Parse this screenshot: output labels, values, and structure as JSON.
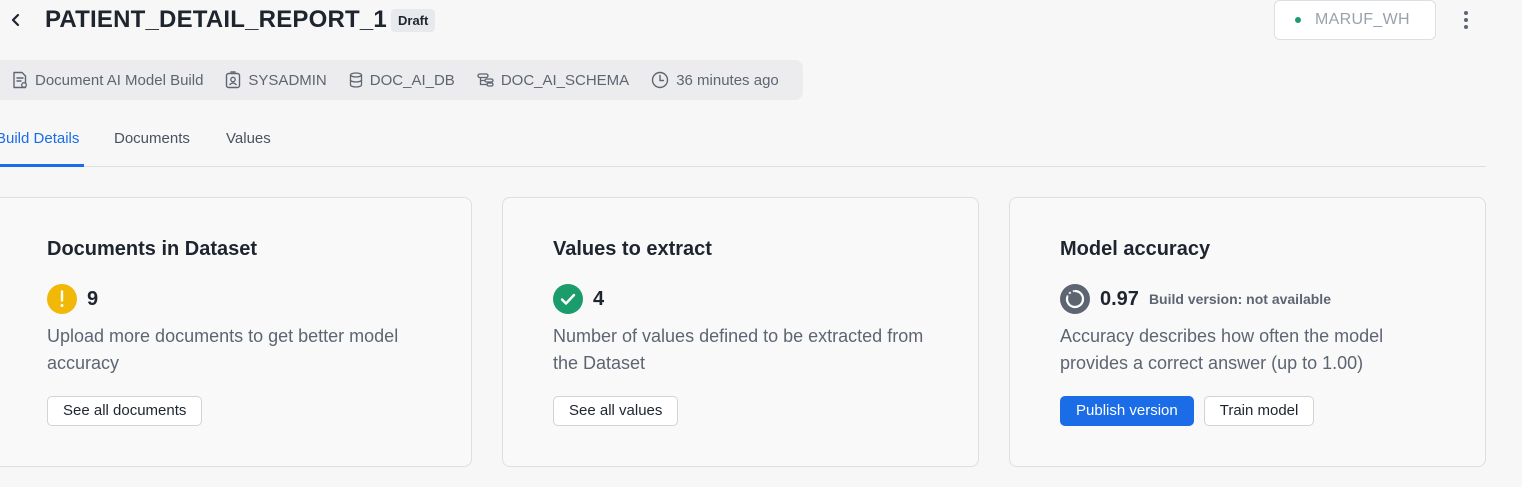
{
  "header": {
    "title": "PATIENT_DETAIL_REPORT_1",
    "badge": "Draft",
    "warehouse": "MARUF_WH"
  },
  "meta": [
    {
      "icon": "document-icon",
      "text": "Document AI Model Build"
    },
    {
      "icon": "user-badge-icon",
      "text": "SYSADMIN"
    },
    {
      "icon": "database-icon",
      "text": "DOC_AI_DB"
    },
    {
      "icon": "schema-icon",
      "text": "DOC_AI_SCHEMA"
    },
    {
      "icon": "clock-icon",
      "text": "36 minutes ago"
    }
  ],
  "tabs": [
    {
      "label": "Build Details",
      "active": true
    },
    {
      "label": "Documents",
      "active": false
    },
    {
      "label": "Values",
      "active": false
    }
  ],
  "cards": [
    {
      "title": "Documents in Dataset",
      "icon": "warning-icon",
      "value": "9",
      "description": "Upload more documents to get better model accuracy",
      "buttons": [
        "See all documents"
      ]
    },
    {
      "title": "Values to extract",
      "icon": "check-icon",
      "value": "4",
      "description": "Number of values defined to be extracted from the Dataset",
      "buttons": [
        "See all values"
      ]
    },
    {
      "title": "Model accuracy",
      "icon": "progress-ring-icon",
      "value": "0.97",
      "sub": "Build version: not available",
      "description": "Accuracy describes how often the model provides a correct answer (up to 1.00)",
      "buttons": [
        "Publish version",
        "Train model"
      ]
    }
  ],
  "colors": {
    "accent": "#1a6ce7",
    "warning": "#f2b807",
    "success": "#1a9c6b",
    "ring": "#5d6573"
  }
}
